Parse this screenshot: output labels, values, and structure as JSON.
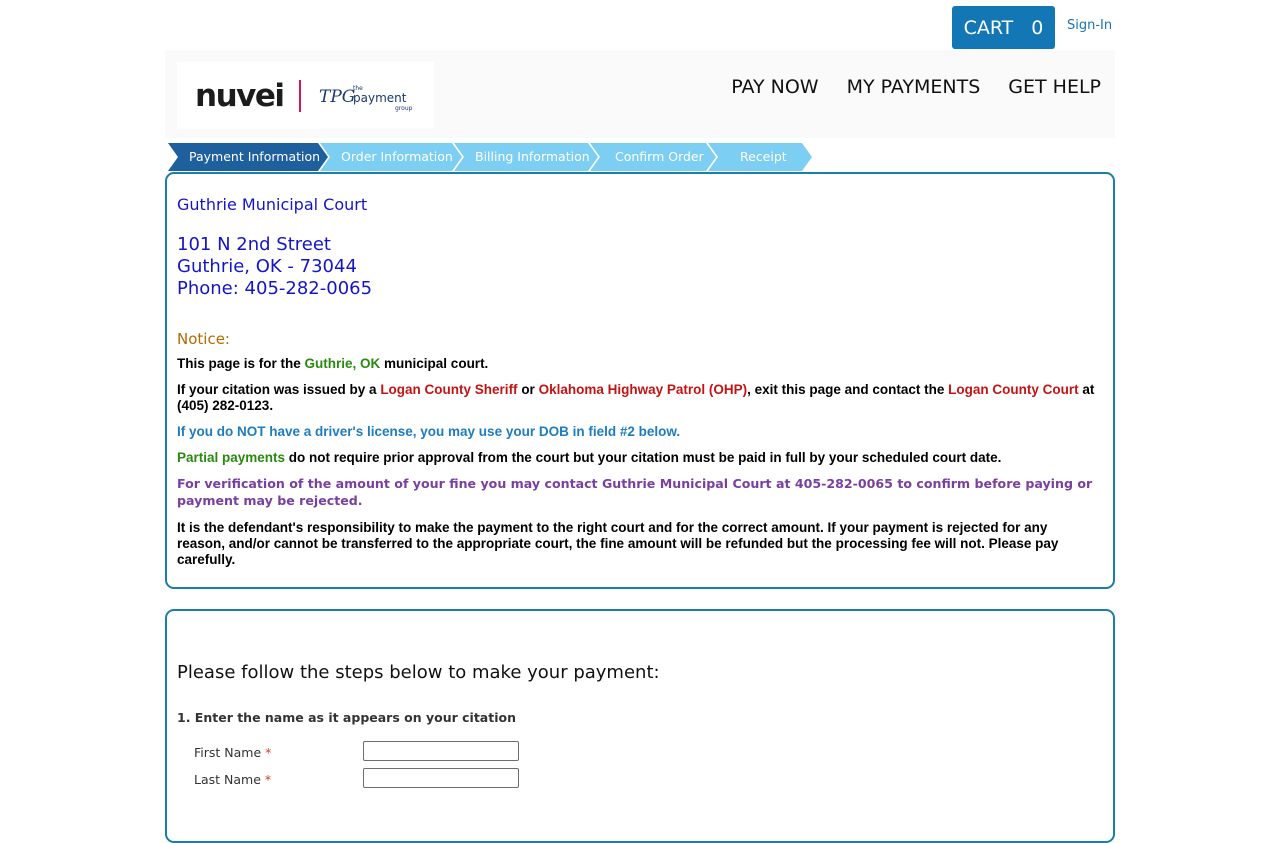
{
  "topbar": {
    "cart_label": "CART",
    "cart_count": "0",
    "signin_label": "Sign-In"
  },
  "logo": {
    "nuvei": "nuvei",
    "tpg_mark": "TPG",
    "tpg_the": "the",
    "tpg_payment": "payment",
    "tpg_group": "group"
  },
  "nav": {
    "items": [
      {
        "label": "PAY NOW"
      },
      {
        "label": "MY PAYMENTS"
      },
      {
        "label": "GET HELP"
      }
    ]
  },
  "steps": {
    "items": [
      {
        "label": "Payment Information"
      },
      {
        "label": "Order Information"
      },
      {
        "label": "Billing Information"
      },
      {
        "label": "Confirm Order"
      },
      {
        "label": "Receipt"
      }
    ]
  },
  "court": {
    "name": "Guthrie Municipal Court",
    "address_line1": "101 N 2nd Street",
    "address_line2": "Guthrie, OK - 73044",
    "phone": "Phone: 405-282-0065"
  },
  "notice": {
    "heading": "Notice:",
    "p1": {
      "a": "This page is for the ",
      "b": "Guthrie, OK",
      "c": " municipal court."
    },
    "p2": {
      "a": "If your citation was issued by a ",
      "b": "Logan County Sheriff",
      "c": " or ",
      "d": "Oklahoma Highway Patrol (OHP)",
      "e": ", exit this page and contact the ",
      "f": "Logan County Court",
      "g": " at (405) 282-0123."
    },
    "p3": "If you do NOT have a driver's license, you may use your DOB in field #2 below.",
    "p4": {
      "a": "Partial payments",
      "b": " do not require prior approval from the court but your citation must be paid in full by your scheduled court date."
    },
    "p5": "For verification of the amount of your fine you may contact Guthrie Municipal Court at 405-282-0065 to confirm before paying or payment may be rejected.",
    "p6": "It is the defendant's responsibility to make the payment to the right court and for the correct amount. If your payment is rejected for any reason, and/or cannot be transferred to the appropriate court, the fine amount will be refunded but the processing fee will not. Please pay carefully."
  },
  "form": {
    "title": "Please follow the steps below to make your payment:",
    "step1_label": "1. Enter the name as it appears on your citation",
    "first_name_label": "First Name",
    "last_name_label": "Last Name",
    "required_mark": "*",
    "first_name_value": "",
    "last_name_value": ""
  },
  "colors": {
    "accent": "#1377b6",
    "panel_border": "#1a7fa6",
    "step_active": "#1e5f9e",
    "step_inactive": "#7ccff2",
    "court_blue": "#1515c8"
  }
}
